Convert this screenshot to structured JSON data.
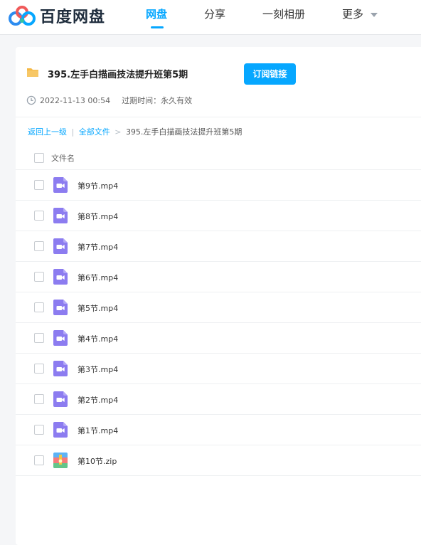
{
  "header": {
    "logo_text": "百度网盘",
    "nav": [
      {
        "label": "网盘",
        "active": true
      },
      {
        "label": "分享",
        "active": false
      },
      {
        "label": "一刻相册",
        "active": false
      },
      {
        "label": "更多",
        "active": false
      }
    ]
  },
  "share": {
    "title": "395.左手白描画技法提升班第5期",
    "subscribe_label": "订阅链接",
    "date": "2022-11-13 00:54",
    "expire_label": "过期时间：",
    "expire_value": "永久有效"
  },
  "breadcrumb": {
    "back": "返回上一级",
    "sep1": "|",
    "all_files": "全部文件",
    "sep2": ">",
    "current": "395.左手白描画技法提升班第5期"
  },
  "list": {
    "column_name": "文件名",
    "files": [
      {
        "name": "第9节.mp4",
        "icon": "video-file-icon"
      },
      {
        "name": "第8节.mp4",
        "icon": "video-file-icon"
      },
      {
        "name": "第7节.mp4",
        "icon": "video-file-icon"
      },
      {
        "name": "第6节.mp4",
        "icon": "video-file-icon"
      },
      {
        "name": "第5节.mp4",
        "icon": "video-file-icon"
      },
      {
        "name": "第4节.mp4",
        "icon": "video-file-icon"
      },
      {
        "name": "第3节.mp4",
        "icon": "video-file-icon"
      },
      {
        "name": "第2节.mp4",
        "icon": "video-file-icon"
      },
      {
        "name": "第1节.mp4",
        "icon": "video-file-icon"
      },
      {
        "name": "第10节.zip",
        "icon": "zip-file-icon"
      }
    ]
  },
  "colors": {
    "accent": "#06a7ff",
    "video_icon": "#8c7cf0",
    "folder": "#f5b845"
  }
}
